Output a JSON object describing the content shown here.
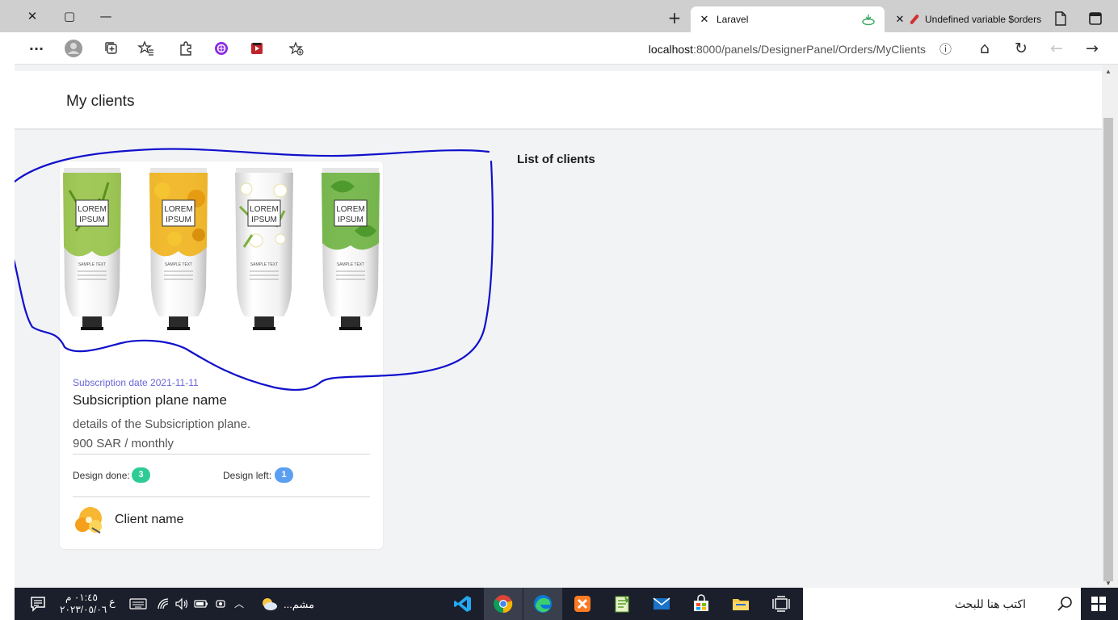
{
  "window": {
    "close_glyph": "✕",
    "restore_glyph": "▢",
    "minimize_glyph": "—",
    "new_tab_glyph": "+"
  },
  "tabs": [
    {
      "title": "Laravel",
      "close_glyph": "✕",
      "active": true
    },
    {
      "title": "Undefined variable $orders (",
      "close_glyph": "✕",
      "active": false
    }
  ],
  "toolbar": {
    "menu_glyph": "···",
    "address_host": "localhost",
    "address_path": ":8000/panels/DesignerPanel/Orders/MyClients",
    "info_glyph": "ⓘ",
    "home_glyph": "⌂",
    "refresh_glyph": "↻",
    "back_glyph": "←",
    "forward_glyph": "→"
  },
  "page": {
    "title": "My clients",
    "section_title": "List of clients"
  },
  "client_card": {
    "subscription_date": "Subscription date 2021-11-11",
    "plan_name": "Subsicription plane name",
    "plan_details": "details of the Subsicription plane.",
    "plan_price": "900 SAR / monthly",
    "design_done_label": "Design done:",
    "design_done_count": "3",
    "design_left_label": "Design left:",
    "design_left_count": "1",
    "client_name": "Client name",
    "product_label_line1": "LOREM",
    "product_label_line2": "IPSUM",
    "product_sample_text": "SAMPLE TEXT"
  },
  "colors": {
    "accent_purple": "#6966d8",
    "badge_done": "#2ecc94",
    "badge_left": "#5a9ff0",
    "annotation_ink": "#1010cc",
    "taskbar": "#1b1f2b"
  },
  "taskbar": {
    "time": "٠١:٤٥ م",
    "date": "٢٠٢٣/٠٥/٠٦",
    "lang_indicator": "ع",
    "weather_text": "...مشم",
    "search_placeholder": "اكتب هنا للبحث",
    "apps": [
      "vscode-icon",
      "chrome-icon",
      "edge-icon",
      "xampp-icon",
      "notepad-icon",
      "mail-icon",
      "store-icon",
      "file-explorer-icon",
      "task-view-icon"
    ]
  }
}
